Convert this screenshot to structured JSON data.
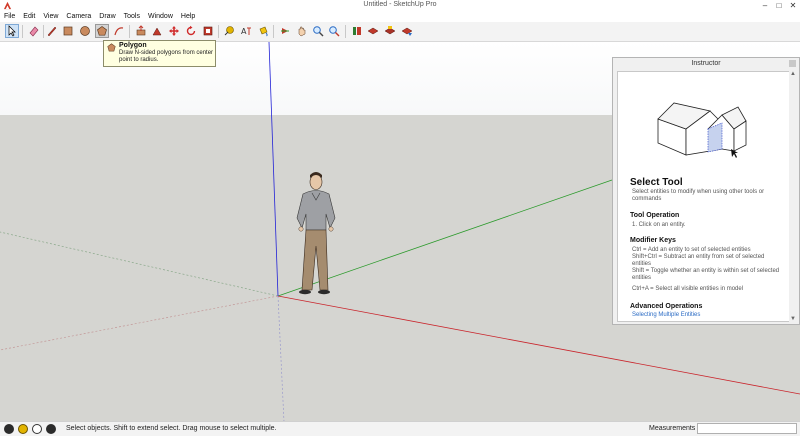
{
  "window": {
    "title": "Untitled - SketchUp Pro"
  },
  "menu": [
    "File",
    "Edit",
    "View",
    "Camera",
    "Draw",
    "Tools",
    "Window",
    "Help"
  ],
  "toolbar": {
    "buttons": [
      "select",
      "eraser",
      "line",
      "rectangle",
      "circle",
      "polygon",
      "arc",
      "push-pull",
      "follow-me",
      "move",
      "rotate",
      "scale",
      "offset",
      "tape-measure",
      "dimension",
      "text",
      "axes",
      "3d-text",
      "orbit",
      "pan",
      "zoom",
      "zoom-extents",
      "previous-view",
      "warehouse",
      "components",
      "extension-warehouse",
      "share"
    ]
  },
  "tooltip": {
    "title": "Polygon",
    "description": "Draw N-sided polygons from center point to radius."
  },
  "instructor": {
    "panel_title": "Instructor",
    "heading": "Select Tool",
    "intro": "Select entities to modify when using other tools or commands",
    "operation_heading": "Tool Operation",
    "operation_step": "1.   Click on an entity.",
    "modifier_heading": "Modifier Keys",
    "modifiers": [
      "Ctrl = Add an entity to set of selected entities",
      "Shift+Ctrl = Subtract an entity from set of selected entities",
      "Shift = Toggle whether an entity is within set of selected entities",
      "Ctrl+A = Select all visible entities in model"
    ],
    "advanced_heading": "Advanced Operations",
    "advanced_link": "Selecting Multiple Entities"
  },
  "status": {
    "text": "Select objects. Shift to extend select. Drag mouse to select multiple.",
    "measurements_label": "Measurements",
    "measurements_value": ""
  },
  "colors": {
    "sky": "#ffffff",
    "ground": "#d5d5d1",
    "red_axis": "#c9242b",
    "green_axis": "#2b9a2b",
    "blue_axis": "#2323d6",
    "accent": "#2a6bc4"
  }
}
